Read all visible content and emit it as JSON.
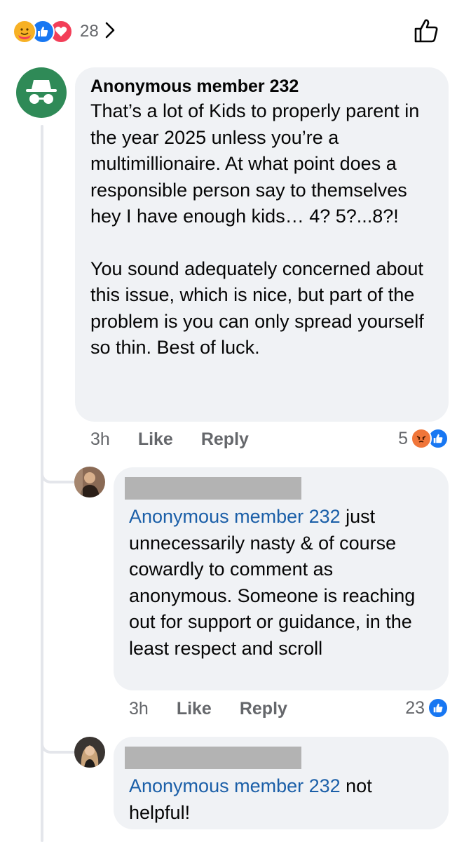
{
  "reactions": {
    "icons": [
      "care-icon",
      "like-icon",
      "love-icon"
    ],
    "count": "28"
  },
  "comments": [
    {
      "author": "Anonymous member 232",
      "paragraphs": [
        "That’s a lot of Kids to properly parent in the year 2025 unless you’re a multimillionaire. At what point does a responsible person say to themselves hey I have enough kids… 4? 5?...8?!",
        "You sound adequately concerned about this issue, which is nice, but part of the problem is you can only spread yourself so thin.   Best of luck."
      ],
      "time": "3h",
      "like_label": "Like",
      "reply_label": "Reply",
      "reaction_count": "5"
    },
    {
      "mention": "Anonymous member 232",
      "text": " just unnecessarily nasty & of course cowardly to comment as anonymous. Someone is reaching out for support or guidance, in the least respect and scroll",
      "time": "3h",
      "like_label": "Like",
      "reply_label": "Reply",
      "reaction_count": "23"
    },
    {
      "mention": "Anonymous member 232",
      "text": " not helpful!"
    }
  ],
  "colors": {
    "bubble": "#f0f2f5",
    "mention": "#1b5fa8",
    "like_blue": "#1877f2",
    "anon_avatar": "#2f8a57"
  }
}
